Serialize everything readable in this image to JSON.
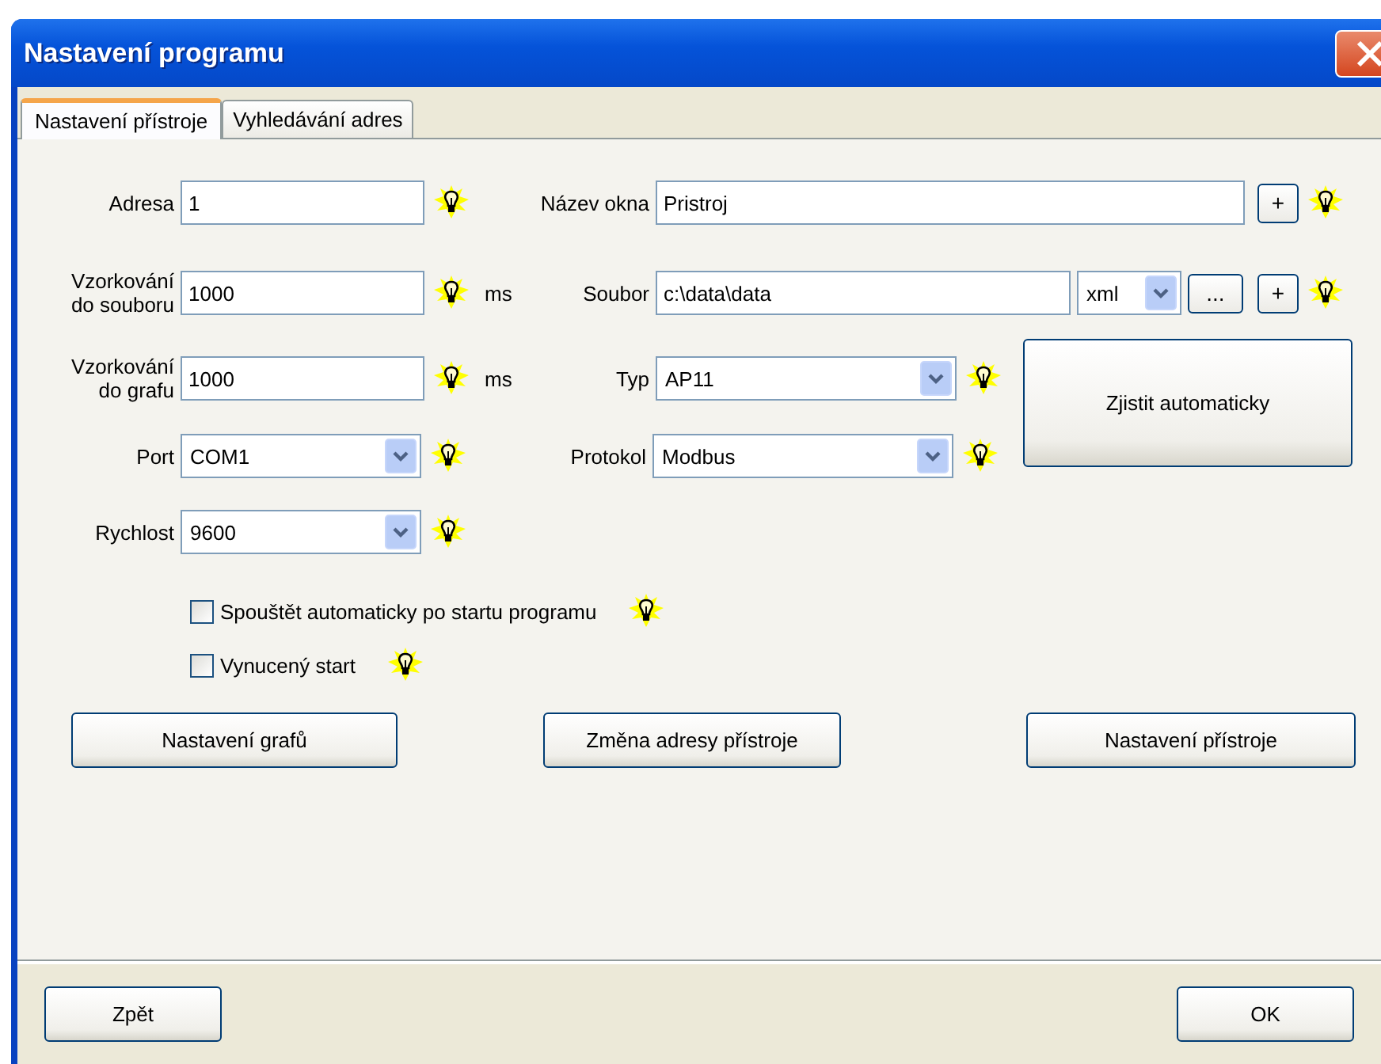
{
  "window": {
    "title": "Nastavení programu"
  },
  "tabs": [
    {
      "label": "Nastavení přístroje",
      "selected": true
    },
    {
      "label": "Vyhledávání adres",
      "selected": false
    }
  ],
  "address": {
    "label": "Adresa",
    "value": "1"
  },
  "window_name": {
    "label": "Název okna",
    "value": "Pristroj",
    "add_button": "+"
  },
  "file_sampling": {
    "label": "Vzorkování do souboru",
    "value": "1000",
    "unit": "ms"
  },
  "file": {
    "label": "Soubor",
    "value": "c:\\data\\data",
    "format": "xml",
    "browse_button": "...",
    "add_button": "+"
  },
  "graph_sampling": {
    "label": "Vzorkování do grafu",
    "value": "1000",
    "unit": "ms"
  },
  "type": {
    "label": "Typ",
    "value": "AP11"
  },
  "detect_button": "Zjistit automaticky",
  "port": {
    "label": "Port",
    "value": "COM1"
  },
  "protocol": {
    "label": "Protokol",
    "value": "Modbus"
  },
  "speed": {
    "label": "Rychlost",
    "value": "9600"
  },
  "checkboxes": [
    {
      "label": "Spouštět automaticky po startu programu",
      "checked": false
    },
    {
      "label": "Vynucený start",
      "checked": false
    }
  ],
  "action_buttons": [
    "Nastavení grafů",
    "Změna adresy přístroje",
    "Nastavení přístroje"
  ],
  "footer_buttons": [
    "Zpět",
    "OK"
  ]
}
